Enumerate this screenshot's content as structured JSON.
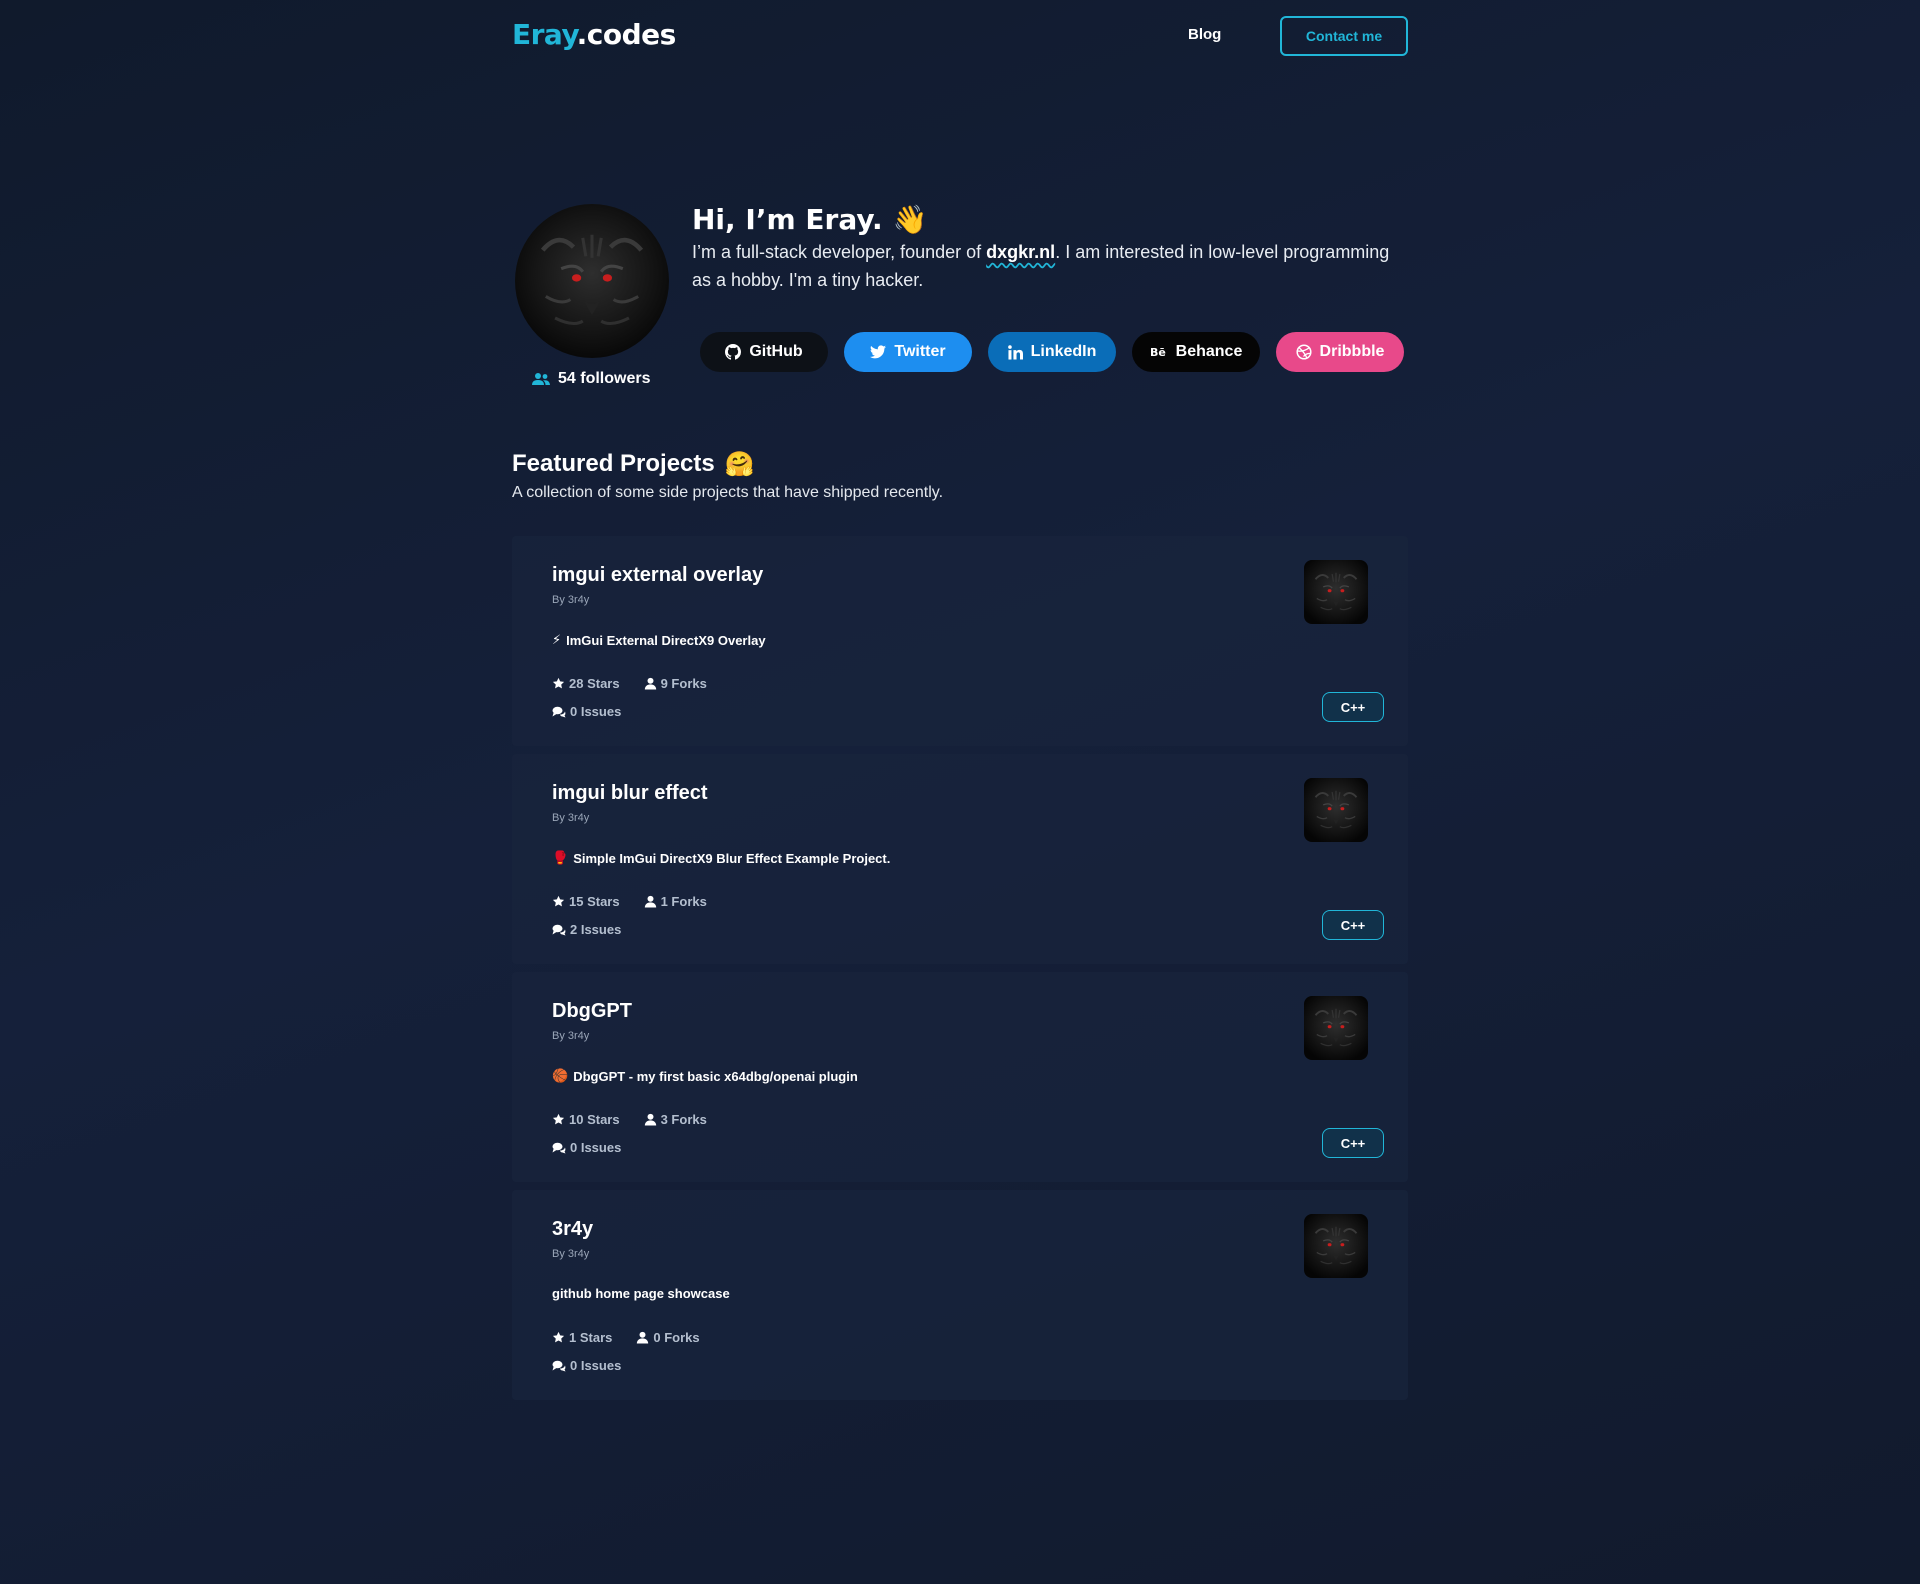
{
  "header": {
    "logo_accent": "Eray",
    "logo_rest": ".codes",
    "nav_blog": "Blog",
    "contact_label": "Contact me"
  },
  "hero": {
    "title": "Hi, I’m Eray.",
    "wave_emoji": "👋",
    "desc_before": "I’m a full-stack developer, founder of ",
    "desc_brand": "dxgkr.nl",
    "desc_after": ". I am interested in low-level programming as a hobby. I'm a tiny hacker.",
    "followers": "54 followers"
  },
  "socials": [
    {
      "label": "GitHub",
      "icon": "github-icon"
    },
    {
      "label": "Twitter",
      "icon": "twitter-icon"
    },
    {
      "label": "LinkedIn",
      "icon": "linkedin-icon"
    },
    {
      "label": "Behance",
      "icon": "behance-icon"
    },
    {
      "label": "Dribbble",
      "icon": "dribbble-icon"
    }
  ],
  "featured": {
    "title": "Featured Projects",
    "emoji": "🤗",
    "subtitle": "A collection of some side projects that have shipped recently."
  },
  "projects": [
    {
      "title": "imgui external overlay",
      "by": "By 3r4y",
      "desc_emoji": "⚡",
      "desc": "ImGui External DirectX9 Overlay",
      "stars": "28 Stars",
      "forks": "9 Forks",
      "issues": "0 Issues",
      "language": "C++"
    },
    {
      "title": "imgui blur effect",
      "by": "By 3r4y",
      "desc_emoji": "🥊",
      "desc": "Simple ImGui DirectX9 Blur Effect Example Project.",
      "stars": "15 Stars",
      "forks": "1 Forks",
      "issues": "2 Issues",
      "language": "C++"
    },
    {
      "title": "DbgGPT",
      "by": "By 3r4y",
      "desc_emoji": "🏀",
      "desc": "DbgGPT - my first basic x64dbg/openai plugin",
      "stars": "10 Stars",
      "forks": "3 Forks",
      "issues": "0 Issues",
      "language": "C++"
    },
    {
      "title": "3r4y",
      "by": "By 3r4y",
      "desc_emoji": "",
      "desc": "github home page showcase",
      "stars": "1 Stars",
      "forks": "0 Forks",
      "issues": "0 Issues",
      "language": ""
    }
  ],
  "colors": {
    "accent": "#21b6d8",
    "background": "#121c30",
    "twitter": "#1d8ef0",
    "linkedin": "#0a6db8",
    "dribbble": "#e8498a"
  }
}
